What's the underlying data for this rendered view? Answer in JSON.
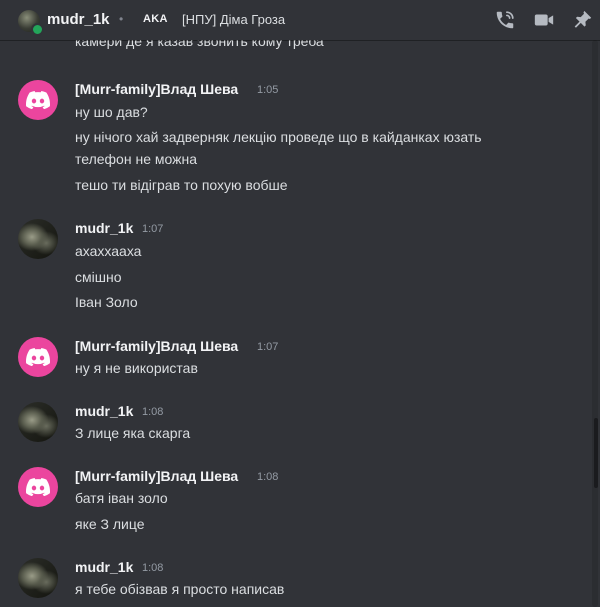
{
  "header": {
    "username": "mudr_1k",
    "separator": "•",
    "aka_label": "AKA",
    "aka_nickname": "[НПУ] Діма Гроза",
    "icons": [
      "phone-call-icon",
      "video-call-icon",
      "pin-icon"
    ],
    "status_color": "#23a55a"
  },
  "clipped_line": "камери де я казав звонить кому треба",
  "messages": [
    {
      "author": "[Murr-family]Влад Шева",
      "time": "1:05",
      "avatar": "discord-logo",
      "lines": [
        "ну шо дав?",
        "ну нічого хай задверняк лекцію проведе що в кайданках юзать",
        "телефон не можна",
        "тешо ти відіграв то похую вобше"
      ]
    },
    {
      "author": "mudr_1k",
      "time": "1:07",
      "avatar": "photo",
      "lines": [
        "ахаххааха",
        "смішно",
        "Іван Золо"
      ]
    },
    {
      "author": "[Murr-family]Влад Шева",
      "time": "1:07",
      "avatar": "discord-logo",
      "lines": [
        "ну я не використав"
      ]
    },
    {
      "author": "mudr_1k",
      "time": "1:08",
      "avatar": "photo",
      "lines": [
        "З лице яка скарга"
      ]
    },
    {
      "author": "[Murr-family]Влад Шева",
      "time": "1:08",
      "avatar": "discord-logo",
      "lines": [
        "батя іван золо",
        "яке З лице"
      ]
    },
    {
      "author": "mudr_1k",
      "time": "1:08",
      "avatar": "photo",
      "lines": [
        "я тебе обізвав я просто написав"
      ]
    }
  ],
  "colors": {
    "background": "#313338",
    "discord_pink": "#eb459e",
    "text": "#dbdee1",
    "timestamp": "#949ba4"
  }
}
